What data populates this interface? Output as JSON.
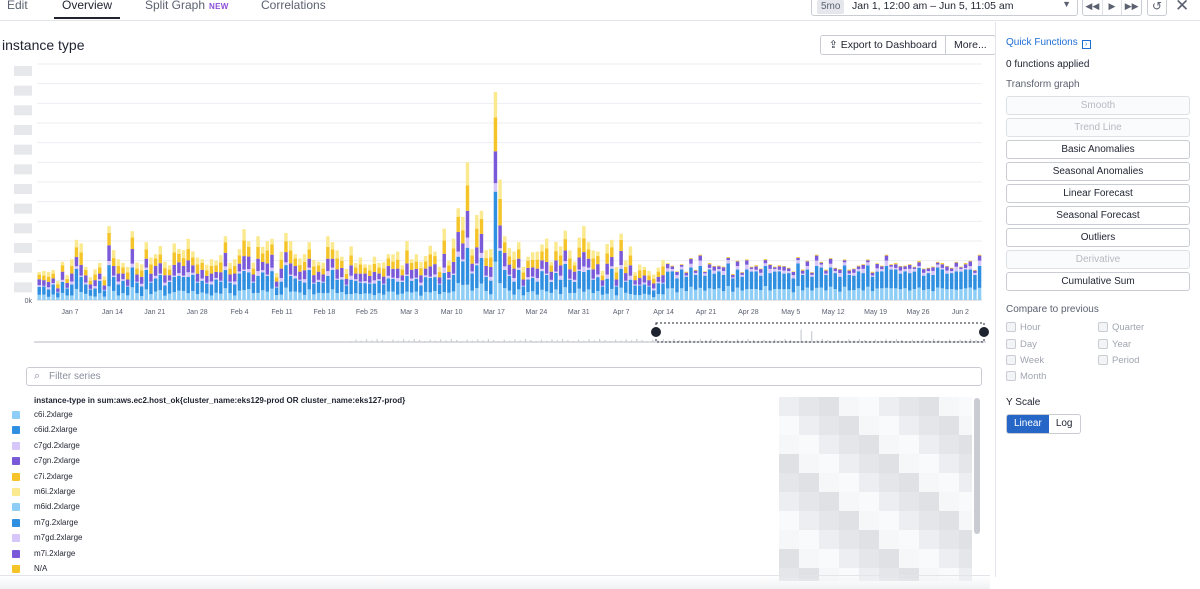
{
  "tabs": [
    {
      "label": "Edit"
    },
    {
      "label": "Overview"
    },
    {
      "label": "Split Graph",
      "badge": "NEW"
    },
    {
      "label": "Correlations"
    }
  ],
  "timepicker": {
    "badge": "5mo",
    "range": "Jan 1, 12:00 am – Jun 5, 11:05 am"
  },
  "graph": {
    "title": "instance type",
    "export_label": "Export to Dashboard",
    "more_label": "More..."
  },
  "filter": {
    "placeholder": "Filter series"
  },
  "legend": {
    "query": "instance-type in sum:aws.ec2.host_ok{cluster_name:eks129-prod OR cluster_name:eks127-prod}",
    "items": [
      {
        "label": "c6i.2xlarge",
        "color": "#8ecdf5"
      },
      {
        "label": "c6id.2xlarge",
        "color": "#2f8fe0"
      },
      {
        "label": "c7gd.2xlarge",
        "color": "#d6c6f9"
      },
      {
        "label": "c7gn.2xlarge",
        "color": "#7a5ad8"
      },
      {
        "label": "c7i.2xlarge",
        "color": "#f5c428"
      },
      {
        "label": "m6i.2xlarge",
        "color": "#fbe98f"
      },
      {
        "label": "m6id.2xlarge",
        "color": "#8ecdf5"
      },
      {
        "label": "m7g.2xlarge",
        "color": "#2f8fe0"
      },
      {
        "label": "m7gd.2xlarge",
        "color": "#d6c6f9"
      },
      {
        "label": "m7i.2xlarge",
        "color": "#7a5ad8"
      },
      {
        "label": "N/A",
        "color": "#f5c428"
      }
    ]
  },
  "chart_data": {
    "type": "bar",
    "stacked": true,
    "y_zero_label": "0k",
    "x_tick_labels": [
      "Jan 7",
      "Jan 14",
      "Jan 21",
      "Jan 28",
      "Feb 4",
      "Feb 11",
      "Feb 18",
      "Feb 25",
      "Mar 3",
      "Mar 10",
      "Mar 17",
      "Mar 24",
      "Mar 31",
      "Apr 7",
      "Apr 14",
      "Apr 21",
      "Apr 28",
      "May 5",
      "May 12",
      "May 19",
      "May 26",
      "Jun 2"
    ],
    "series_colors": [
      "#8ecdf5",
      "#2f8fe0",
      "#d6c6f9",
      "#7a5ad8",
      "#f5c428",
      "#fbe98f"
    ],
    "bar_totals": [
      1.1,
      1.4,
      1.1,
      1.3,
      0.8,
      1.5,
      1.2,
      1.6,
      2.6,
      2.4,
      1.3,
      1.1,
      1.2,
      1.6,
      1.0,
      2.9,
      2.4,
      1.6,
      1.6,
      1.4,
      2.7,
      1.8,
      1.4,
      2.5,
      1.8,
      1.8,
      2.6,
      1.5,
      1.5,
      2.4,
      2.0,
      2.4,
      2.4,
      2.1,
      1.8,
      1.6,
      1.7,
      1.6,
      1.7,
      1.9,
      2.5,
      1.8,
      1.6,
      2.2,
      3.0,
      2.3,
      1.8,
      2.5,
      2.3,
      2.5,
      2.4,
      1.3,
      1.9,
      2.9,
      2.5,
      1.8,
      2.0,
      1.8,
      2.5,
      1.7,
      1.5,
      1.8,
      2.5,
      2.5,
      2.1,
      1.7,
      1.5,
      2.1,
      1.6,
      1.8,
      1.4,
      1.7,
      1.7,
      1.6,
      1.6,
      1.8,
      2.2,
      1.9,
      1.5,
      2.5,
      1.6,
      2.2,
      1.5,
      1.9,
      2.3,
      1.9,
      1.6,
      2.8,
      1.7,
      2.6,
      3.6,
      4.0,
      5.4,
      2.2,
      3.6,
      3.5,
      2.4,
      2.0,
      9.0,
      5.1,
      2.5,
      2.5,
      1.9,
      2.5,
      1.4,
      1.7,
      2.3,
      1.9,
      2.4,
      2.6,
      1.5,
      2.8,
      2.1,
      3.0,
      2.1,
      1.5,
      3.0,
      2.9,
      2.5,
      2.1,
      1.9,
      1.4,
      2.2,
      2.6,
      1.4,
      2.6,
      1.9,
      2.1,
      1.2,
      1.5,
      1.3,
      1.4,
      1.0,
      1.4,
      1.7,
      1.4,
      1.6,
      1.2,
      1.5,
      1.3,
      1.6,
      1.4,
      1.9,
      1.2,
      1.7,
      1.3,
      1.6,
      1.4,
      1.8,
      1.2,
      1.5,
      1.3,
      1.7,
      1.4,
      1.6,
      1.2,
      1.9,
      1.5,
      1.4,
      1.6,
      1.3,
      1.5,
      1.2,
      1.8,
      1.4,
      1.5,
      1.3,
      1.9,
      1.6,
      1.4,
      1.6,
      1.5,
      1.3,
      1.7,
      1.4,
      1.2,
      1.6,
      1.5,
      1.7,
      1.3,
      1.4,
      1.6,
      1.9,
      1.5,
      1.7,
      1.3,
      1.6,
      1.5,
      1.4,
      1.8,
      1.2,
      1.5,
      1.4,
      1.6,
      1.7,
      1.3,
      1.5,
      1.6,
      1.4,
      1.7,
      1.5,
      1.4,
      1.9
    ],
    "ylim": [
      0,
      10
    ]
  },
  "quick_functions": {
    "title": "Quick Functions",
    "applied": "0 functions applied",
    "transform_label": "Transform graph",
    "buttons": [
      {
        "label": "Smooth",
        "disabled": true
      },
      {
        "label": "Trend Line",
        "disabled": true
      },
      {
        "label": "Basic Anomalies",
        "disabled": false
      },
      {
        "label": "Seasonal Anomalies",
        "disabled": false
      },
      {
        "label": "Linear Forecast",
        "disabled": false
      },
      {
        "label": "Seasonal Forecast",
        "disabled": false
      },
      {
        "label": "Outliers",
        "disabled": false
      },
      {
        "label": "Derivative",
        "disabled": true
      },
      {
        "label": "Cumulative Sum",
        "disabled": false
      }
    ],
    "compare_label": "Compare to previous",
    "compare_options": [
      "Hour",
      "Quarter",
      "Day",
      "Year",
      "Week",
      "Period",
      "Month"
    ],
    "yscale_label": "Y Scale",
    "yscale_options": [
      "Linear",
      "Log"
    ],
    "yscale_selected": "Linear"
  }
}
